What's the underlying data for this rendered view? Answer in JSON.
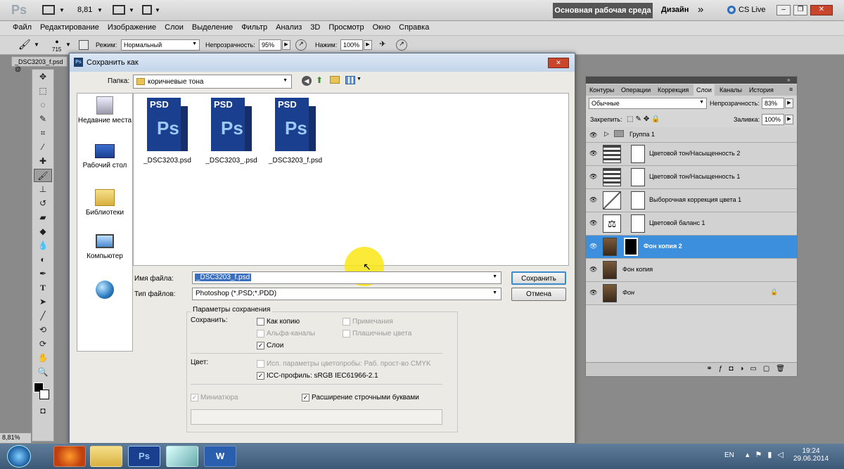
{
  "app": {
    "logo": "Ps",
    "zoom": "8,81",
    "workspace": "Основная рабочая среда",
    "design": "Дизайн",
    "more": "»",
    "cslive": "CS Live"
  },
  "menu": [
    "Файл",
    "Редактирование",
    "Изображение",
    "Слои",
    "Выделение",
    "Фильтр",
    "Анализ",
    "3D",
    "Просмотр",
    "Окно",
    "Справка"
  ],
  "options": {
    "brush_size": "715",
    "mode_label": "Режим:",
    "mode_value": "Нормальный",
    "opacity_label": "Непрозрачность:",
    "opacity_value": "95%",
    "pressure_label": "Нажим:",
    "pressure_value": "100%"
  },
  "doc_tab": "_DSC3203_f.psd @",
  "zoom_status": "8,81%",
  "dialog": {
    "title": "Сохранить как",
    "folder_label": "Папка:",
    "folder_value": "коричневые тона",
    "close": "✕",
    "places": [
      "Недавние места",
      "Рабочий стол",
      "Библиотеки",
      "Компьютер",
      ""
    ],
    "files": [
      "_DSC3203.psd",
      "_DSC3203_.psd",
      "_DSC3203_f.psd"
    ],
    "psd_badge": "PSD",
    "psd_ps": "Ps",
    "filename_label": "Имя файла:",
    "filename_value": "_DSC3203_f.psd",
    "filetype_label": "Тип файлов:",
    "filetype_value": "Photoshop (*.PSD;*.PDD)",
    "save_btn": "Сохранить",
    "cancel_btn": "Отмена",
    "opts_title": "Параметры сохранения",
    "save_label": "Сохранить:",
    "as_copy": "Как копию",
    "alpha": "Альфа-каналы",
    "layers": "Слои",
    "notes": "Примечания",
    "spot": "Плашечные цвета",
    "color_label": "Цвет:",
    "proof": "Исп. параметры цветопробы:  Раб. прост-во CMYK",
    "icc": "ICC-профиль:  sRGB IEC61966-2.1",
    "thumb": "Миниатюра",
    "ext": "Расширение строчными буквами"
  },
  "panel": {
    "tabs": [
      "Контуры",
      "Операции",
      "Коррекция",
      "Слои",
      "Каналы",
      "История"
    ],
    "active_tab": "Слои",
    "blend": "Обычные",
    "opacity_label": "Непрозрачность:",
    "opacity_value": "83%",
    "lock_label": "Закрепить:",
    "fill_label": "Заливка:",
    "fill_value": "100%",
    "layers": [
      "Группа 1",
      "Цветовой тон/Насыщенность 2",
      "Цветовой тон/Насыщенность 1",
      "Выборочная коррекция цвета 1",
      "Цветовой баланс 1",
      "Фон копия 2",
      "Фон копия",
      "Фон"
    ]
  },
  "taskbar": {
    "lang": "EN",
    "time": "19:24",
    "date": "29.06.2014",
    "ps": "Ps",
    "word": "W"
  }
}
